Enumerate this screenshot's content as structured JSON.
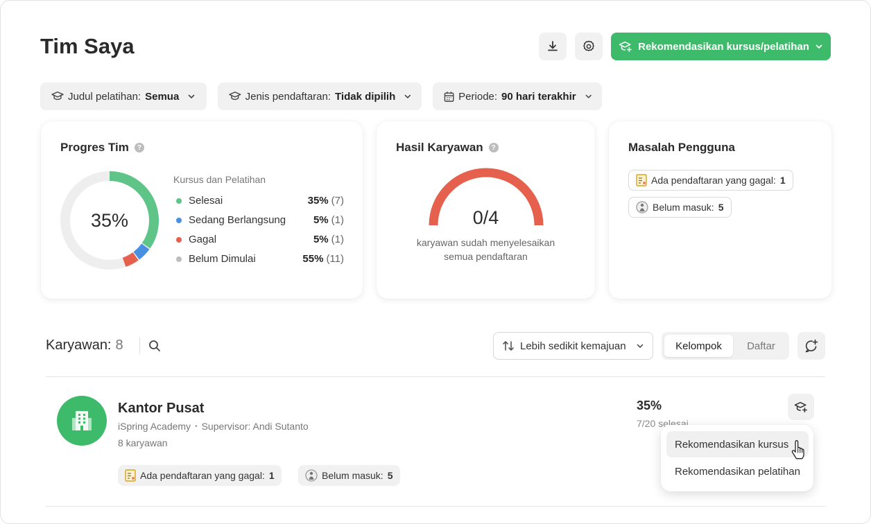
{
  "header": {
    "title": "Tim Saya",
    "download_icon": "download-icon",
    "settings_icon": "gear-icon",
    "recommend_button": "Rekomendasikan kursus/pelatihan"
  },
  "filters": [
    {
      "label": "Judul pelatihan:",
      "value": "Semua",
      "icon": "graduation-cap-icon"
    },
    {
      "label": "Jenis pendaftaran:",
      "value": "Tidak dipilih",
      "icon": "graduation-cap-icon"
    },
    {
      "label": "Periode:",
      "value": "90 hari terakhir",
      "icon": "calendar-icon"
    }
  ],
  "team_progress": {
    "title": "Progres Tim",
    "center_value": "35%",
    "legend_title": "Kursus dan Pelatihan",
    "items": [
      {
        "label": "Selesai",
        "pct": "35%",
        "count": "(7)",
        "value": 35,
        "color": "#5ec488"
      },
      {
        "label": "Sedang Berlangsung",
        "pct": "5%",
        "count": "(1)",
        "value": 5,
        "color": "#4a90e2"
      },
      {
        "label": "Gagal",
        "pct": "5%",
        "count": "(1)",
        "value": 5,
        "color": "#e5604d"
      },
      {
        "label": "Belum Dimulai",
        "pct": "55%",
        "count": "(11)",
        "value": 55,
        "color": "#bdbdbd"
      }
    ]
  },
  "employee_results": {
    "title": "Hasil Karyawan",
    "value": "0/4",
    "caption_line1": "karyawan sudah menyelesaikan",
    "caption_line2": "semua pendaftaran",
    "gauge_color": "#e5604d"
  },
  "user_issues": {
    "title": "Masalah Pengguna",
    "chips": [
      {
        "label": "Ada pendaftaran yang gagal:",
        "value": "1",
        "icon": "failed-enrollment-icon"
      },
      {
        "label": "Belum masuk:",
        "value": "5",
        "icon": "not-logged-in-icon"
      }
    ]
  },
  "employees": {
    "label": "Karyawan:",
    "count": "8",
    "sort_label": "Lebih sedikit kemajuan",
    "view_group": "Kelompok",
    "view_list": "Daftar"
  },
  "group": {
    "name": "Kantor Pusat",
    "org": "iSpring Academy",
    "supervisor": "Supervisor: Andi Sutanto",
    "members": "8 karyawan",
    "pct": "35%",
    "done": "7/20 selesai",
    "chips": [
      {
        "label": "Ada pendaftaran yang gagal:",
        "value": "1"
      },
      {
        "label": "Belum masuk:",
        "value": "5"
      }
    ]
  },
  "menu": {
    "item1": "Rekomendasikan kursus",
    "item2": "Rekomendasikan pelatihan"
  },
  "colors": {
    "accent": "#3dbb6a",
    "completed": "#5ec488",
    "in_progress": "#4a90e2",
    "failed": "#e5604d",
    "not_started": "#bdbdbd"
  }
}
